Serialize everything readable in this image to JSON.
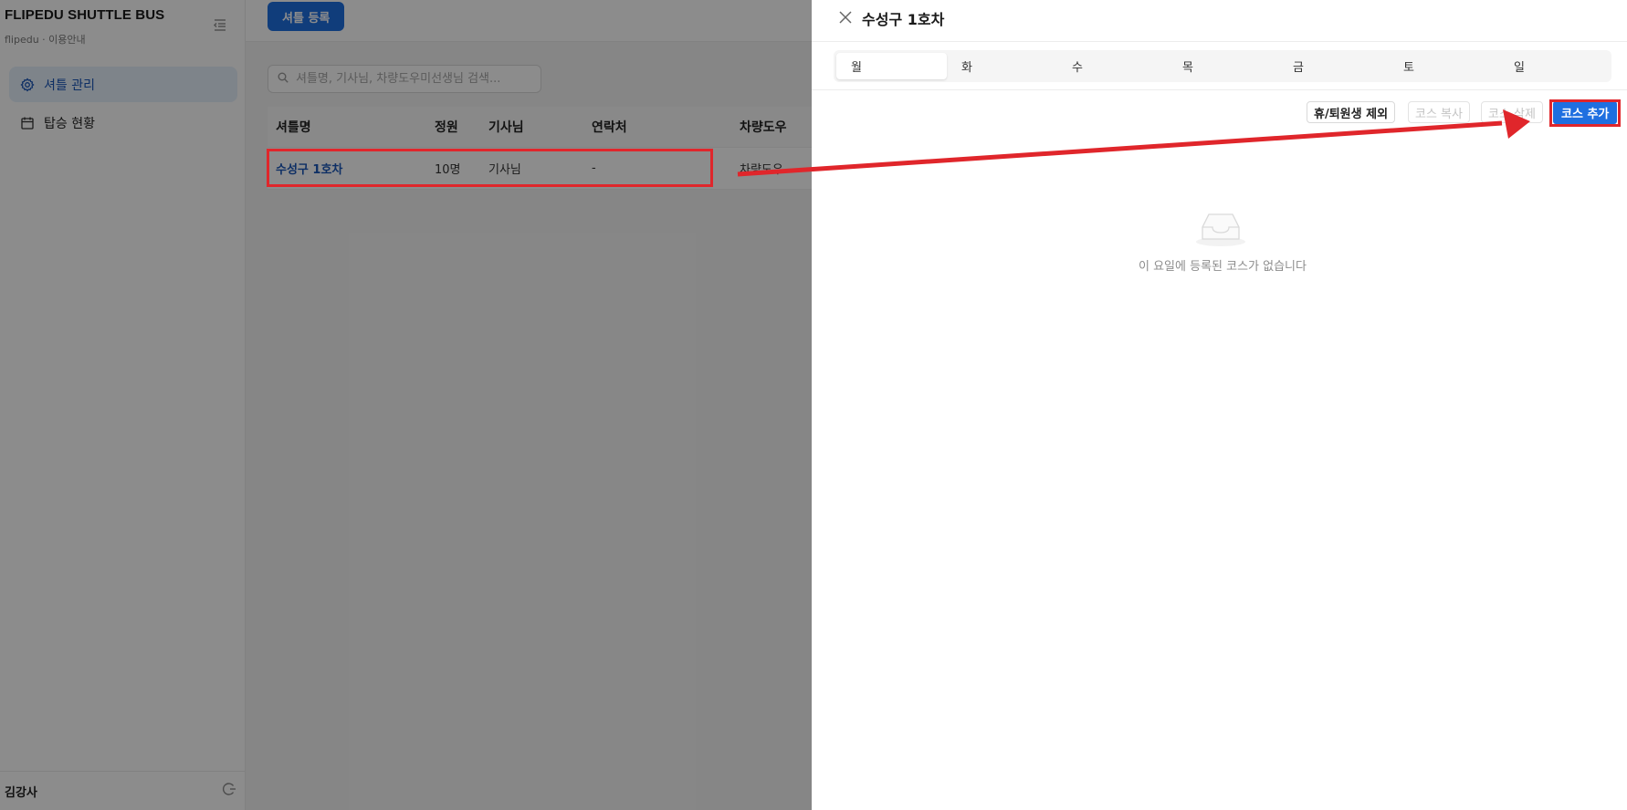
{
  "sidebar": {
    "brand_title": "FLIPEDU SHUTTLE BUS",
    "brand_subtitle": "flipedu · 이용안내",
    "items": [
      {
        "label": "셔틀 관리",
        "icon": "gear-icon",
        "active": true
      },
      {
        "label": "탑승 현황",
        "icon": "calendar-icon",
        "active": false
      }
    ],
    "footer_user": "김강사"
  },
  "main": {
    "register_button": "셔틀 등록",
    "search_placeholder": "셔틀명, 기사님, 차량도우미선생님 검색...",
    "table": {
      "headers": [
        "셔틀명",
        "정원",
        "기사님",
        "연락처",
        "차량도우"
      ],
      "rows": [
        [
          "수성구 1호차",
          "10명",
          "기사님",
          "-",
          "차량도우"
        ]
      ]
    }
  },
  "drawer": {
    "title": "수성구 1호차",
    "day_tabs": [
      "월",
      "화",
      "수",
      "목",
      "금",
      "토",
      "일"
    ],
    "selected_day": "월",
    "actions": {
      "exclude": "휴/퇴원생 제외",
      "copy": "코스 복사",
      "delete": "코스 삭제",
      "add": "코스 추가"
    },
    "empty_message": "이 요일에 등록된 코스가 없습니다"
  },
  "colors": {
    "accent": "#1e6fe0",
    "annotation": "#e0262b"
  }
}
